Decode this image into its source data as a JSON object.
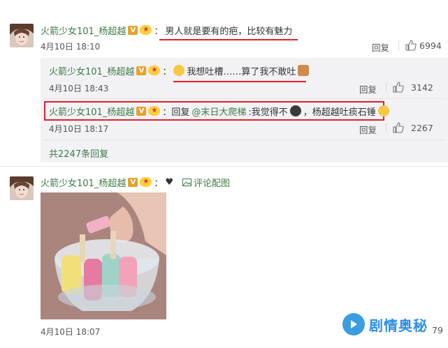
{
  "comment1": {
    "user": "火箭少女101_杨超越",
    "badge_v": "V",
    "colon": "：",
    "text": "男人就是要有的疤，比较有魅力",
    "time": "4月10日 18:10",
    "reply_label": "回复",
    "likes": "6994"
  },
  "reply1": {
    "user": "火箭少女101_杨超越",
    "colon": "：",
    "text": "我想吐槽……算了我不敢吐",
    "time": "4月10日 18:43",
    "reply_label": "回复",
    "likes": "3142"
  },
  "reply2": {
    "user": "火箭少女101_杨超越",
    "prefix": "：回复",
    "mention": "@末日大爬梯",
    "text_a": ":我觉得不",
    "text_b": "，杨超越吐痰石锤",
    "time": "4月10日 18:17",
    "reply_label": "回复",
    "likes": "2267"
  },
  "more_replies": "共2247条回复",
  "comment2": {
    "user": "火箭少女101_杨超越",
    "colon": "：",
    "heart": "♥",
    "pic_link": "评论配图",
    "time": "4月10日 18:07"
  },
  "watermark": {
    "text": "剧情奥秘",
    "partial_count": "79"
  },
  "colors": {
    "username": "#3d7a45",
    "highlight": "#e0202a",
    "reply_bg": "#f2f2f5",
    "watermark": "#2f8fe0"
  },
  "icons": [
    "thumbs-up-icon",
    "image-icon",
    "v-verified-icon",
    "star-badge-icon",
    "emoji-icon"
  ]
}
